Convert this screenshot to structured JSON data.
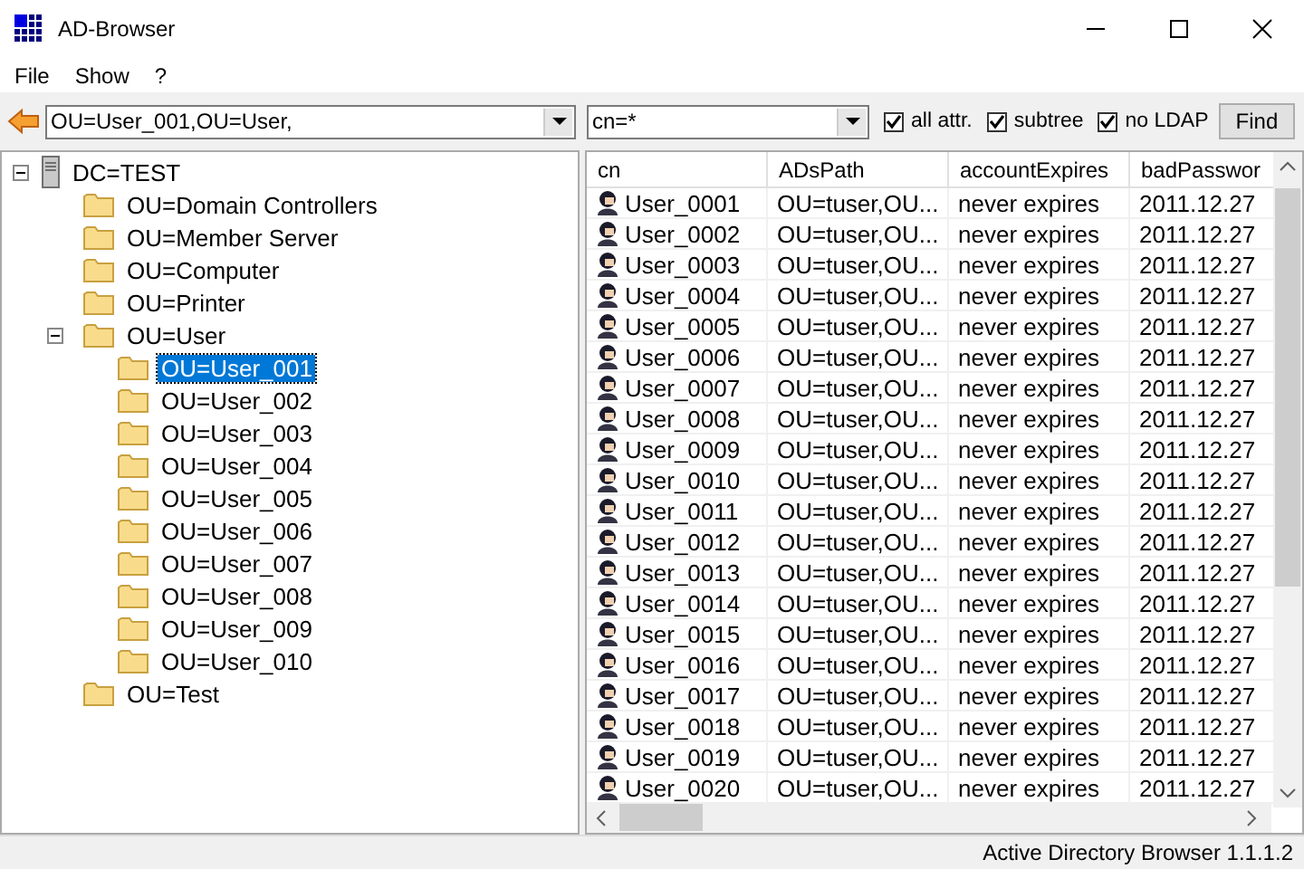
{
  "window": {
    "title": "AD-Browser"
  },
  "menu": [
    "File",
    "Show",
    "?"
  ],
  "toolbar": {
    "path": "OU=User_001,OU=User,",
    "filter": "cn=*",
    "options": [
      {
        "label": "all attr.",
        "checked": true
      },
      {
        "label": "subtree",
        "checked": true
      },
      {
        "label": "no LDAP",
        "checked": true
      }
    ],
    "find": "Find"
  },
  "tree": [
    {
      "label": "DC=TEST",
      "kind": "server",
      "expanded": true,
      "selected": false,
      "children": [
        {
          "label": "OU=Domain Controllers",
          "kind": "folder",
          "selected": false
        },
        {
          "label": "OU=Member Server",
          "kind": "folder",
          "selected": false
        },
        {
          "label": "OU=Computer",
          "kind": "folder",
          "selected": false
        },
        {
          "label": "OU=Printer",
          "kind": "folder",
          "selected": false
        },
        {
          "label": "OU=User",
          "kind": "folder",
          "expanded": true,
          "selected": false,
          "children": [
            {
              "label": "OU=User_001",
              "kind": "folder",
              "selected": true
            },
            {
              "label": "OU=User_002",
              "kind": "folder",
              "selected": false
            },
            {
              "label": "OU=User_003",
              "kind": "folder",
              "selected": false
            },
            {
              "label": "OU=User_004",
              "kind": "folder",
              "selected": false
            },
            {
              "label": "OU=User_005",
              "kind": "folder",
              "selected": false
            },
            {
              "label": "OU=User_006",
              "kind": "folder",
              "selected": false
            },
            {
              "label": "OU=User_007",
              "kind": "folder",
              "selected": false
            },
            {
              "label": "OU=User_008",
              "kind": "folder",
              "selected": false
            },
            {
              "label": "OU=User_009",
              "kind": "folder",
              "selected": false
            },
            {
              "label": "OU=User_010",
              "kind": "folder",
              "selected": false
            }
          ]
        },
        {
          "label": "OU=Test",
          "kind": "folder",
          "selected": false
        }
      ]
    }
  ],
  "table": {
    "columns": [
      "cn",
      "ADsPath",
      "accountExpires",
      "badPasswor"
    ],
    "rows": [
      [
        "User_0001",
        "OU=tuser,OU...",
        "never expires",
        "2011.12.27"
      ],
      [
        "User_0002",
        "OU=tuser,OU...",
        "never expires",
        "2011.12.27"
      ],
      [
        "User_0003",
        "OU=tuser,OU...",
        "never expires",
        "2011.12.27"
      ],
      [
        "User_0004",
        "OU=tuser,OU...",
        "never expires",
        "2011.12.27"
      ],
      [
        "User_0005",
        "OU=tuser,OU...",
        "never expires",
        "2011.12.27"
      ],
      [
        "User_0006",
        "OU=tuser,OU...",
        "never expires",
        "2011.12.27"
      ],
      [
        "User_0007",
        "OU=tuser,OU...",
        "never expires",
        "2011.12.27"
      ],
      [
        "User_0008",
        "OU=tuser,OU...",
        "never expires",
        "2011.12.27"
      ],
      [
        "User_0009",
        "OU=tuser,OU...",
        "never expires",
        "2011.12.27"
      ],
      [
        "User_0010",
        "OU=tuser,OU...",
        "never expires",
        "2011.12.27"
      ],
      [
        "User_0011",
        "OU=tuser,OU...",
        "never expires",
        "2011.12.27"
      ],
      [
        "User_0012",
        "OU=tuser,OU...",
        "never expires",
        "2011.12.27"
      ],
      [
        "User_0013",
        "OU=tuser,OU...",
        "never expires",
        "2011.12.27"
      ],
      [
        "User_0014",
        "OU=tuser,OU...",
        "never expires",
        "2011.12.27"
      ],
      [
        "User_0015",
        "OU=tuser,OU...",
        "never expires",
        "2011.12.27"
      ],
      [
        "User_0016",
        "OU=tuser,OU...",
        "never expires",
        "2011.12.27"
      ],
      [
        "User_0017",
        "OU=tuser,OU...",
        "never expires",
        "2011.12.27"
      ],
      [
        "User_0018",
        "OU=tuser,OU...",
        "never expires",
        "2011.12.27"
      ],
      [
        "User_0019",
        "OU=tuser,OU...",
        "never expires",
        "2011.12.27"
      ],
      [
        "User_0020",
        "OU=tuser,OU...",
        "never expires",
        "2011.12.27"
      ]
    ]
  },
  "status_bar": "Active Directory Browser 1.1.1.2"
}
